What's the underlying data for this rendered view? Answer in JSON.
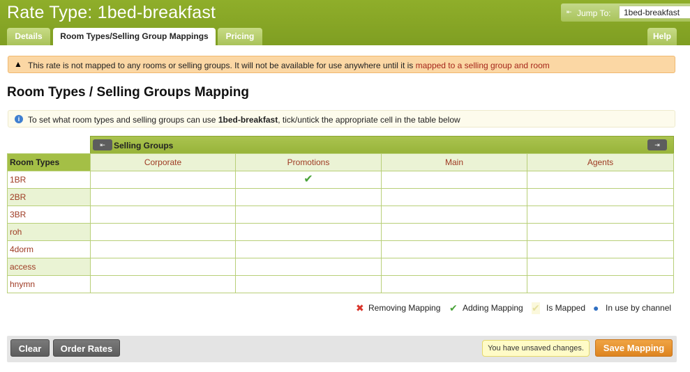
{
  "header": {
    "title": "Rate Type: 1bed-breakfast",
    "jump_label": "Jump To:",
    "jump_value": "1bed-breakfast"
  },
  "tabs": [
    {
      "label": "Details",
      "active": false
    },
    {
      "label": "Room Types/Selling Group Mappings",
      "active": true
    },
    {
      "label": "Pricing",
      "active": false
    }
  ],
  "help_label": "Help",
  "warning": {
    "text": "This rate is not mapped to any rooms or selling groups. It will not be available for use anywhere until it is ",
    "link": "mapped to a selling group and room"
  },
  "section_title": "Room Types / Selling Groups Mapping",
  "info": {
    "prefix": "To set what room types and selling groups can use ",
    "rate": "1bed-breakfast",
    "suffix": ", tick/untick the appropriate cell in the table below"
  },
  "grid": {
    "selling_groups_label": "Selling Groups",
    "room_types_label": "Room Types",
    "columns": [
      "Corporate",
      "Promotions",
      "Main",
      "Agents"
    ],
    "rows": [
      "1BR",
      "2BR",
      "3BR",
      "roh",
      "4dorm",
      "access",
      "hnymn"
    ],
    "mapped": {
      "1BR": [
        "Promotions"
      ]
    }
  },
  "legend": {
    "removing": "Removing Mapping",
    "adding": "Adding Mapping",
    "is_mapped": "Is Mapped",
    "in_use": "In use by channel"
  },
  "buttons": {
    "clear": "Clear",
    "order_rates": "Order Rates",
    "unsaved_notice": "You have unsaved changes.",
    "save": "Save Mapping"
  },
  "colors": {
    "header_green": "#8fae2a",
    "link_red": "#9e3a23",
    "save_orange": "#e8922f"
  }
}
